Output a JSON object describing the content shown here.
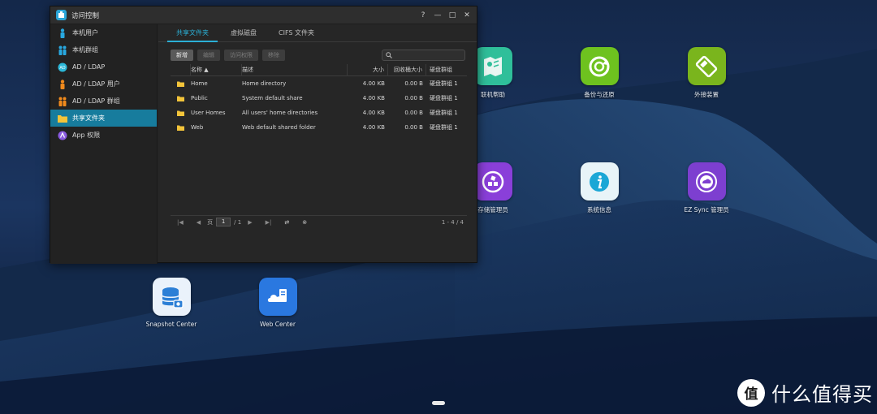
{
  "window": {
    "title": "访问控制",
    "controls": {
      "help": "?",
      "minimize": "—",
      "maximize": "□",
      "close": "✕"
    }
  },
  "sidebar": {
    "items": [
      {
        "label": "本机用户",
        "icon": "user-icon"
      },
      {
        "label": "本机群组",
        "icon": "group-icon"
      },
      {
        "label": "AD / LDAP",
        "icon": "ldap-icon"
      },
      {
        "label": "AD / LDAP 用户",
        "icon": "ldap-user-icon"
      },
      {
        "label": "AD / LDAP 群组",
        "icon": "ldap-group-icon"
      },
      {
        "label": "共享文件夹",
        "icon": "shared-folder-icon",
        "active": true
      },
      {
        "label": "App 权限",
        "icon": "app-permission-icon"
      }
    ]
  },
  "tabs": [
    {
      "label": "共享文件夹",
      "active": true
    },
    {
      "label": "虚拟磁盘"
    },
    {
      "label": "CIFS 文件夹"
    }
  ],
  "toolbar": {
    "add": "新增",
    "edit": "编辑",
    "access": "访问权限",
    "remove": "移除"
  },
  "table": {
    "headers": {
      "name": "名称 ▲",
      "desc": "描述",
      "size": "大小",
      "recycle": "回收桶大小",
      "group": "硬盘群组"
    },
    "rows": [
      {
        "name": "Home",
        "desc": "Home directory",
        "size": "4.00 KB",
        "recycle": "0.00 B",
        "group": "硬盘群组 1"
      },
      {
        "name": "Public",
        "desc": "System default share",
        "size": "4.00 KB",
        "recycle": "0.00 B",
        "group": "硬盘群组 1"
      },
      {
        "name": "User Homes",
        "desc": "All users' home directories",
        "size": "4.00 KB",
        "recycle": "0.00 B",
        "group": "硬盘群组 1"
      },
      {
        "name": "Web",
        "desc": "Web default shared folder",
        "size": "4.00 KB",
        "recycle": "0.00 B",
        "group": "硬盘群组 1"
      }
    ]
  },
  "pager": {
    "page_prefix": "页",
    "page_value": "1",
    "page_total": "/ 1",
    "range": "1 - 4 / 4"
  },
  "desktop": {
    "icons": [
      {
        "label": "联机帮助",
        "icon": "map-help-icon",
        "color": "#2fbf9a"
      },
      {
        "label": "备份与还原",
        "icon": "backup-restore-icon",
        "color": "#6ec21f"
      },
      {
        "label": "外接装置",
        "icon": "usb-device-icon",
        "color": "#7ab51d"
      },
      {
        "label": "存储管理员",
        "icon": "storage-manager-icon",
        "color": "#8a3fd9"
      },
      {
        "label": "系统信息",
        "icon": "info-icon",
        "color": "#1ba7d6"
      },
      {
        "label": "EZ Sync 管理员",
        "icon": "ez-sync-icon",
        "color": "#7d3fd0"
      },
      {
        "label": "Snapshot Center",
        "icon": "snapshot-center-icon",
        "color": "#2c7fd6"
      },
      {
        "label": "Web Center",
        "icon": "web-center-icon",
        "color": "#2a78e0"
      }
    ]
  },
  "watermark": {
    "text": "什么值得买",
    "logo": "值"
  }
}
